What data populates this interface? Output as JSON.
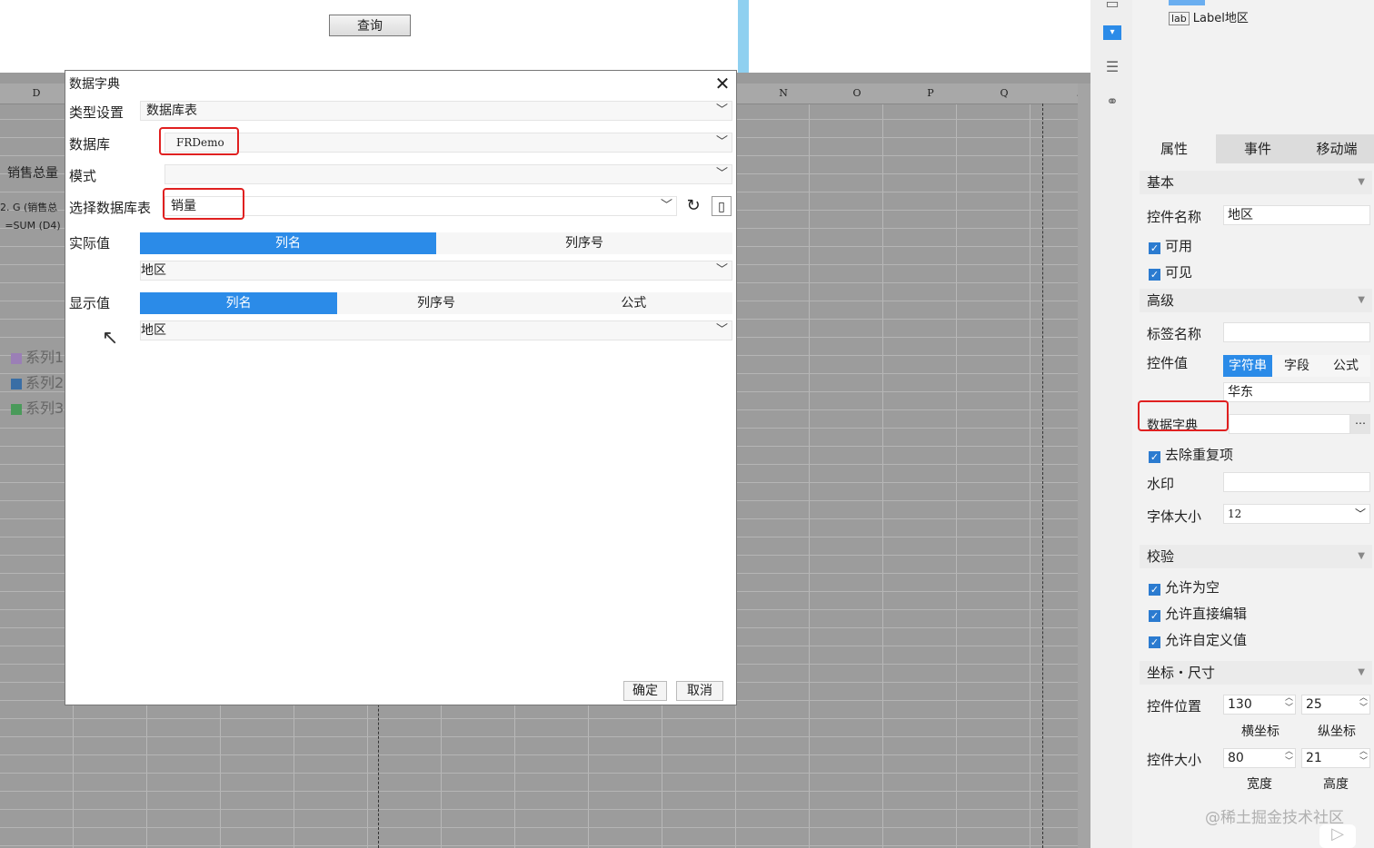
{
  "toolbar": {
    "query_button": "查询"
  },
  "sheet": {
    "columns": [
      "D",
      "N",
      "O",
      "P",
      "Q"
    ],
    "left_cells": [
      "销售总量",
      "2. G (销售总",
      "=SUM (D4)"
    ],
    "legend": [
      {
        "label": "系列1",
        "color": "#9b7fb6"
      },
      {
        "label": "系列2",
        "color": "#3a6ea5"
      },
      {
        "label": "系列3",
        "color": "#4a9a5a"
      }
    ]
  },
  "dialog": {
    "title": "数据字典",
    "type_label": "类型设置",
    "type_value": "数据库表",
    "db_label": "数据库",
    "db_value": "FRDemo",
    "mode_label": "模式",
    "mode_value": "",
    "table_label": "选择数据库表",
    "table_value": "销量",
    "actual_label": "实际值",
    "actual_tabs": [
      "列名",
      "列序号"
    ],
    "actual_value": "地区",
    "display_label": "显示值",
    "display_tabs": [
      "列名",
      "列序号",
      "公式"
    ],
    "display_value": "地区",
    "ok": "确定",
    "cancel": "取消"
  },
  "panel": {
    "tree_item": "Label地区",
    "tabs": [
      "属性",
      "事件",
      "移动端"
    ],
    "basic": {
      "section": "基本",
      "name_label": "控件名称",
      "name_value": "地区",
      "enabled": "可用",
      "visible": "可见"
    },
    "advanced": {
      "section": "高级",
      "tag_label": "标签名称",
      "tag_value": "",
      "value_label": "控件值",
      "value_tabs": [
        "字符串",
        "字段",
        "公式"
      ],
      "value_text": "华东",
      "dict_label": "数据字典",
      "dedupe": "去除重复项",
      "watermark_label": "水印",
      "font_label": "字体大小",
      "font_value": "12"
    },
    "validate": {
      "section": "校验",
      "allow_empty": "允许为空",
      "allow_edit": "允许直接编辑",
      "allow_custom": "允许自定义值"
    },
    "geometry": {
      "section": "坐标・尺寸",
      "pos_label": "控件位置",
      "pos_x": "130",
      "pos_y": "25",
      "x_caption": "横坐标",
      "y_caption": "纵坐标",
      "size_label": "控件大小",
      "width": "80",
      "height": "21",
      "w_caption": "宽度",
      "h_caption": "高度"
    }
  },
  "watermark": "@稀土掘金技术社区",
  "colors": {
    "accent": "#2b8be8",
    "highlight": "#e02020"
  }
}
